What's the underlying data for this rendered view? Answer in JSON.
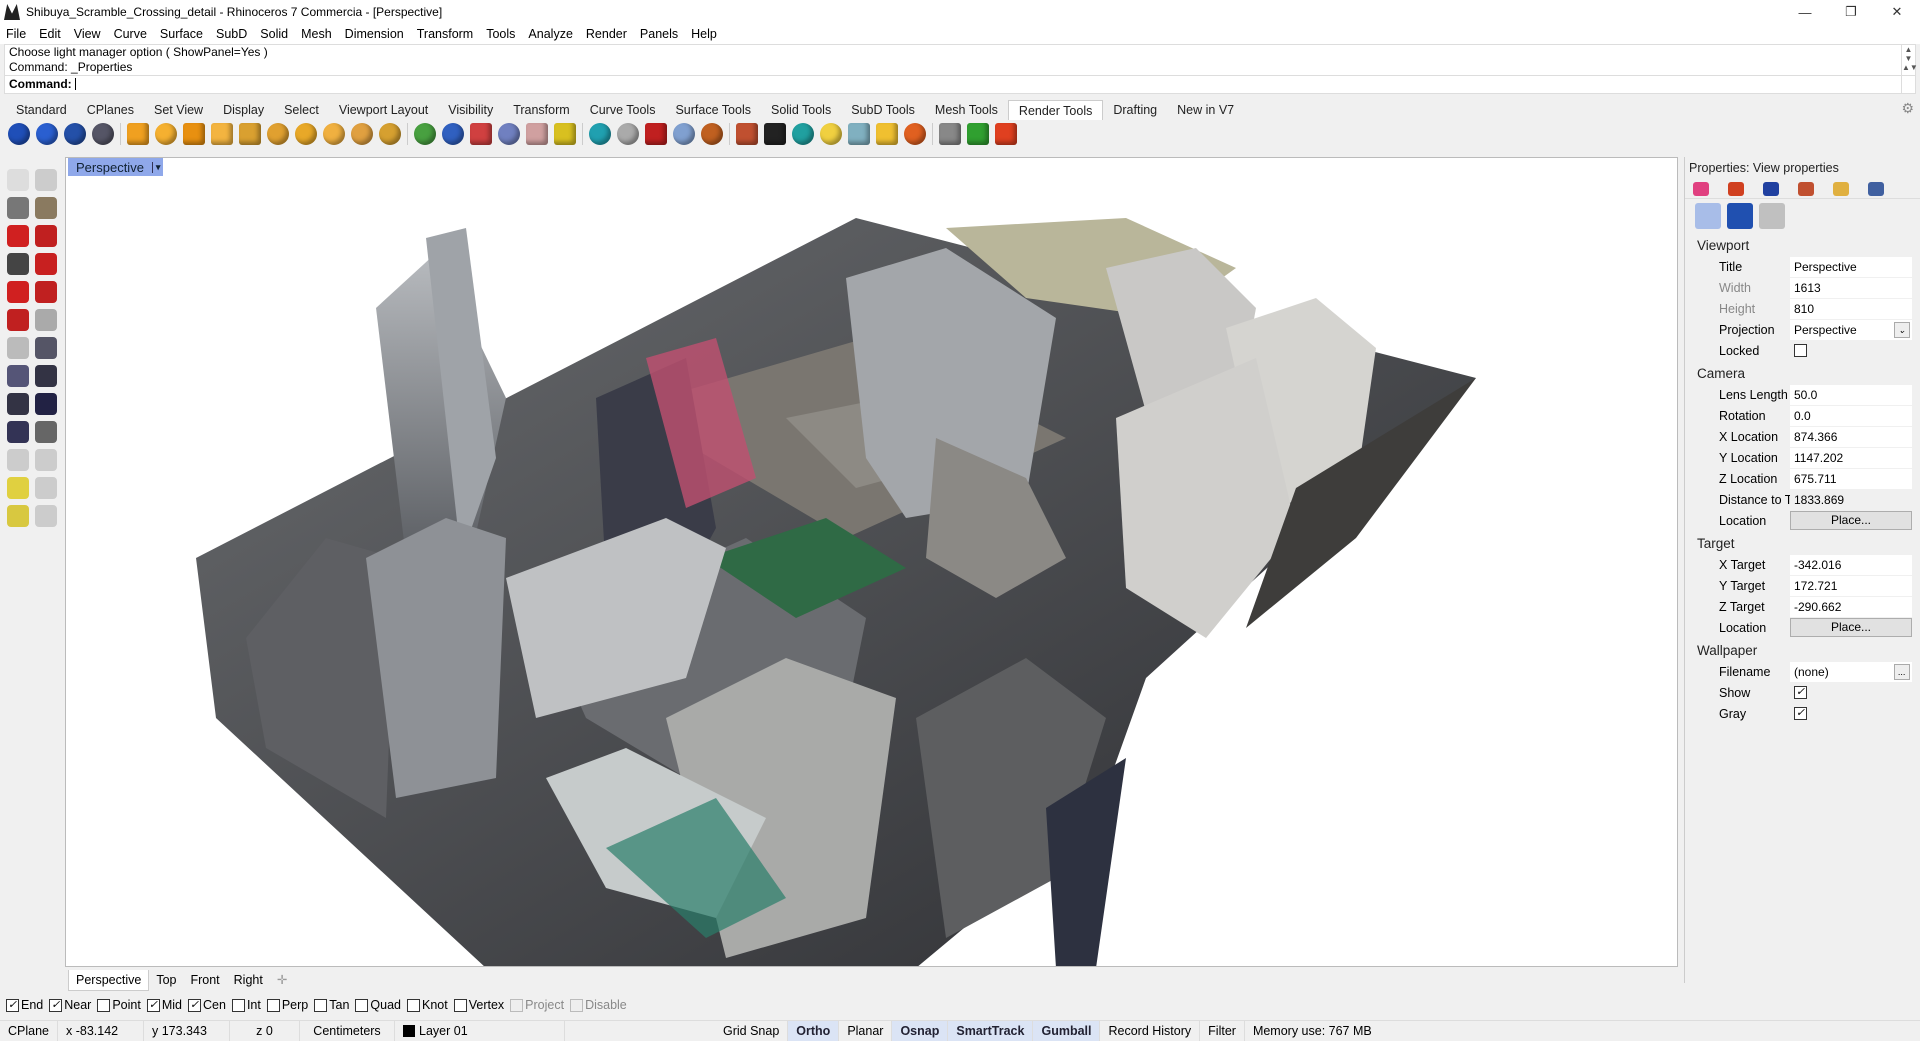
{
  "window": {
    "title": "Shibuya_Scramble_Crossing_detail - Rhinoceros 7 Commercia - [Perspective]",
    "minimize": "—",
    "maximize": "❐",
    "close": "✕"
  },
  "menu": [
    "File",
    "Edit",
    "View",
    "Curve",
    "Surface",
    "SubD",
    "Solid",
    "Mesh",
    "Dimension",
    "Transform",
    "Tools",
    "Analyze",
    "Render",
    "Panels",
    "Help"
  ],
  "command": {
    "history": [
      "Choose light manager option ( ShowPanel=Yes )",
      "Command: _Properties"
    ],
    "prompt": "Command:",
    "value": ""
  },
  "toolbar_tabs": [
    "Standard",
    "CPlanes",
    "Set View",
    "Display",
    "Select",
    "Viewport Layout",
    "Visibility",
    "Transform",
    "Curve Tools",
    "Surface Tools",
    "Solid Tools",
    "SubD Tools",
    "Mesh Tools",
    "Render Tools",
    "Drafting",
    "New in V7"
  ],
  "active_tab": "Render Tools",
  "toolbar_icons": [
    {
      "name": "render-icon",
      "color": "#1f4fb8"
    },
    {
      "name": "render-preview-icon",
      "color": "#2a5fd0"
    },
    {
      "name": "render-window-icon",
      "color": "#2450a8"
    },
    {
      "name": "save-render-icon",
      "color": "#556"
    },
    {
      "name": "spotlight-icon",
      "color": "#f0a020",
      "sq": 1
    },
    {
      "name": "point-light-icon",
      "color": "#f5b030"
    },
    {
      "name": "directional-light-icon",
      "color": "#e89010",
      "sq": 1
    },
    {
      "name": "rectangular-light-icon",
      "color": "#f3b440",
      "sq": 1
    },
    {
      "name": "linear-light-icon",
      "color": "#d9a030",
      "sq": 1
    },
    {
      "name": "light-manager-icon",
      "color": "#e0a030"
    },
    {
      "name": "sun-icon",
      "color": "#e8a828"
    },
    {
      "name": "set-light-icon",
      "color": "#f0b040"
    },
    {
      "name": "edit-light-icon",
      "color": "#e0a040"
    },
    {
      "name": "light-options-icon",
      "color": "#d6a030"
    },
    {
      "name": "material-editor-icon",
      "color": "#48a040"
    },
    {
      "name": "environment-editor-icon",
      "color": "#3060c0"
    },
    {
      "name": "texture-editor-icon",
      "color": "#d04040",
      "sq": 1
    },
    {
      "name": "decal-icon",
      "color": "#7080c0"
    },
    {
      "name": "texture-mapping-icon",
      "color": "#d0a0a0",
      "sq": 1
    },
    {
      "name": "mapping-widget-icon",
      "color": "#d8c020",
      "sq": 1
    },
    {
      "name": "ground-plane-icon",
      "color": "#20a0b0"
    },
    {
      "name": "turntable-icon",
      "color": "#aaa"
    },
    {
      "name": "render-library-icon",
      "color": "#c02020",
      "sq": 1
    },
    {
      "name": "sky-icon",
      "color": "#80a0d0"
    },
    {
      "name": "basketball-icon",
      "color": "#c06020"
    },
    {
      "name": "dimension-icon",
      "color": "#c05030",
      "sq": 1
    },
    {
      "name": "checker-icon",
      "color": "#222",
      "sq": 1
    },
    {
      "name": "water-icon",
      "color": "#20a0a0"
    },
    {
      "name": "lamp-icon",
      "color": "#f0d040"
    },
    {
      "name": "render-mesh-icon",
      "color": "#80b0c0",
      "sq": 1
    },
    {
      "name": "folder-icon",
      "color": "#f0c030",
      "sq": 1
    },
    {
      "name": "explode-icon",
      "color": "#e06020"
    },
    {
      "name": "render-frame-icon",
      "color": "#888",
      "sq": 1
    },
    {
      "name": "play-icon",
      "color": "#30a030",
      "sq": 1
    },
    {
      "name": "record-icon",
      "color": "#e04020",
      "sq": 1
    }
  ],
  "left_toolbar": [
    {
      "name": "select-icon",
      "color": "#ddd"
    },
    {
      "name": "points-on-icon",
      "color": "#ccc"
    },
    {
      "name": "car-gray-icon",
      "color": "#777"
    },
    {
      "name": "car-garage-icon",
      "color": "#8a7a60"
    },
    {
      "name": "car-red-icon",
      "color": "#d02020"
    },
    {
      "name": "car-top-icon",
      "color": "#c02020"
    },
    {
      "name": "car-tires-icon",
      "color": "#444"
    },
    {
      "name": "car-sedan-icon",
      "color": "#c82020"
    },
    {
      "name": "car-hatch-icon",
      "color": "#d02020"
    },
    {
      "name": "car-front-icon",
      "color": "#c02020"
    },
    {
      "name": "car-small-icon",
      "color": "#c02020"
    },
    {
      "name": "ball-icon",
      "color": "#aaa"
    },
    {
      "name": "two-balls-icon",
      "color": "#bbb"
    },
    {
      "name": "plane-front-icon",
      "color": "#556"
    },
    {
      "name": "jet-icon",
      "color": "#557"
    },
    {
      "name": "plane-small-icon",
      "color": "#334"
    },
    {
      "name": "plane-top-icon",
      "color": "#334"
    },
    {
      "name": "plane-side-icon",
      "color": "#224"
    },
    {
      "name": "plane-blue-icon",
      "color": "#335"
    },
    {
      "name": "cube-icon",
      "color": "#666"
    },
    {
      "name": "zoom-window-icon",
      "color": "#ccc"
    },
    {
      "name": "zoom-selected-icon",
      "color": "#ccc"
    },
    {
      "name": "zoom-extents-icon",
      "color": "#e0d040"
    },
    {
      "name": "target-icon",
      "color": "#ccc"
    },
    {
      "name": "zoom-all-icon",
      "color": "#d8c840"
    },
    {
      "name": "undo-view-icon",
      "color": "#ccc"
    }
  ],
  "viewport": {
    "title": "Perspective",
    "menu_arrow": "▾"
  },
  "viewport_tabs": [
    "Perspective",
    "Top",
    "Front",
    "Right"
  ],
  "viewport_tab_add": "✛",
  "osnaps": [
    {
      "label": "End",
      "checked": true
    },
    {
      "label": "Near",
      "checked": true
    },
    {
      "label": "Point",
      "checked": false
    },
    {
      "label": "Mid",
      "checked": true
    },
    {
      "label": "Cen",
      "checked": true
    },
    {
      "label": "Int",
      "checked": false
    },
    {
      "label": "Perp",
      "checked": false
    },
    {
      "label": "Tan",
      "checked": false
    },
    {
      "label": "Quad",
      "checked": false
    },
    {
      "label": "Knot",
      "checked": false
    },
    {
      "label": "Vertex",
      "checked": false
    },
    {
      "label": "Project",
      "checked": false,
      "disabled": true
    },
    {
      "label": "Disable",
      "checked": false,
      "disabled": true
    }
  ],
  "status": {
    "cplane": "CPlane",
    "x": "x -83.142",
    "y": "y 173.343",
    "z": "z 0",
    "units": "Centimeters",
    "layer": "Layer 01",
    "toggles": [
      {
        "label": "Grid Snap",
        "on": false
      },
      {
        "label": "Ortho",
        "on": true
      },
      {
        "label": "Planar",
        "on": false
      },
      {
        "label": "Osnap",
        "on": true
      },
      {
        "label": "SmartTrack",
        "on": true
      },
      {
        "label": "Gumball",
        "on": true
      },
      {
        "label": "Record History",
        "on": false
      },
      {
        "label": "Filter",
        "on": false
      }
    ],
    "memory": "Memory use: 767 MB"
  },
  "properties": {
    "header": "Properties: View properties",
    "tab_icons": [
      {
        "name": "color-wheel-icon",
        "color": "#e04080"
      },
      {
        "name": "material-icon",
        "color": "#d04020"
      },
      {
        "name": "environment-icon",
        "color": "#2040a0"
      },
      {
        "name": "object-icon",
        "color": "#c05030"
      },
      {
        "name": "folder-icon",
        "color": "#e0b040"
      },
      {
        "name": "render-settings-icon",
        "color": "#4060a0"
      }
    ],
    "sub_icons": [
      {
        "name": "camera-icon",
        "color": "#a8bde8"
      },
      {
        "name": "named-views-icon",
        "color": "#2050b0"
      },
      {
        "name": "wallpaper-icon",
        "color": "#c0c0c0"
      }
    ],
    "sections": [
      {
        "title": "Viewport",
        "rows": [
          {
            "label": "Title",
            "value": "Perspective"
          },
          {
            "label": "Width",
            "value": "1613",
            "gray": true
          },
          {
            "label": "Height",
            "value": "810",
            "gray": true
          },
          {
            "label": "Projection",
            "value": "Perspective",
            "dropdown": true
          },
          {
            "label": "Locked",
            "checkbox": false
          }
        ]
      },
      {
        "title": "Camera",
        "rows": [
          {
            "label": "Lens Length",
            "value": "50.0"
          },
          {
            "label": "Rotation",
            "value": "0.0"
          },
          {
            "label": "X Location",
            "value": "874.366"
          },
          {
            "label": "Y Location",
            "value": "1147.202"
          },
          {
            "label": "Z Location",
            "value": "675.711"
          },
          {
            "label": "Distance to Ta...",
            "value": "1833.869",
            "plain": true
          },
          {
            "label": "Location",
            "button": "Place..."
          }
        ]
      },
      {
        "title": "Target",
        "rows": [
          {
            "label": "X Target",
            "value": "-342.016"
          },
          {
            "label": "Y Target",
            "value": "172.721"
          },
          {
            "label": "Z Target",
            "value": "-290.662"
          },
          {
            "label": "Location",
            "button": "Place..."
          }
        ]
      },
      {
        "title": "Wallpaper",
        "rows": [
          {
            "label": "Filename",
            "value": "(none)",
            "browse": "..."
          },
          {
            "label": "Show",
            "checkbox": true
          },
          {
            "label": "Gray",
            "checkbox": true
          }
        ]
      }
    ]
  }
}
